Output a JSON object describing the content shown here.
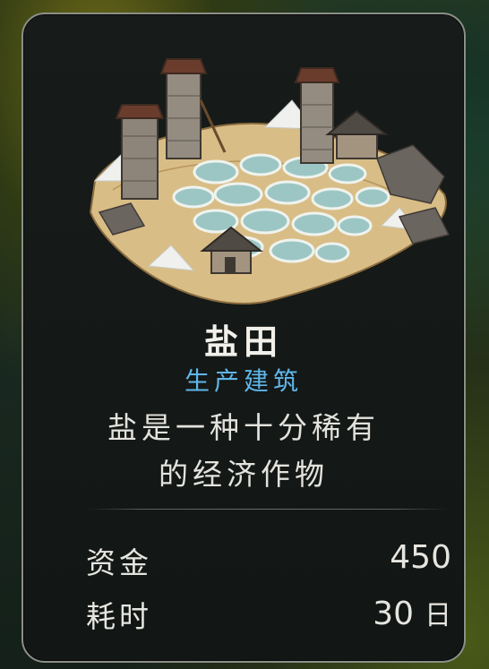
{
  "building": {
    "name": "盐田",
    "category": "生产建筑",
    "description_lines": [
      "盐是一种十分稀有",
      "的经济作物"
    ]
  },
  "stats": [
    {
      "label": "资金",
      "value": "450",
      "unit": ""
    },
    {
      "label": "耗时",
      "value": "30",
      "unit": "日"
    }
  ],
  "colors": {
    "category": "#5fb6ea",
    "text": "#e6e5e0",
    "panel": "#151917",
    "border": "#8b8f88"
  },
  "icons": {
    "illustration": "salt-field-illustration"
  }
}
